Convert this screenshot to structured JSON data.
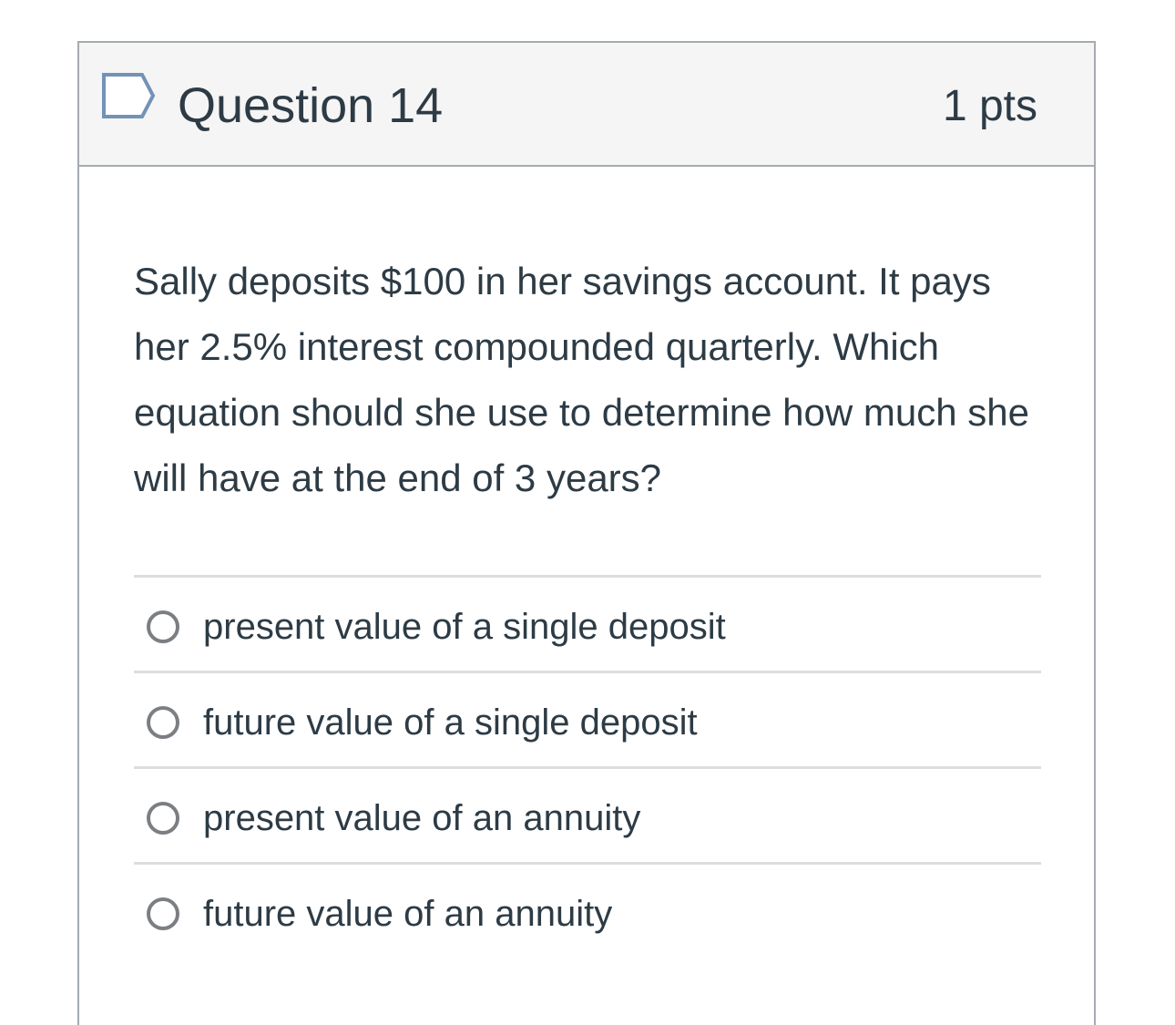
{
  "question": {
    "title": "Question 14",
    "points": "1 pts",
    "flag_icon": "flag-outline-icon",
    "text": "Sally deposits $100 in her savings account. It pays her 2.5% interest compounded quarterly. Which equation should she use to determine how much she will have at the end of 3 years?"
  },
  "answers": [
    {
      "label": "present value of a single deposit"
    },
    {
      "label": "future value of a single deposit"
    },
    {
      "label": "present value of an annuity"
    },
    {
      "label": "future value of an annuity"
    }
  ],
  "colors": {
    "text": "#2d3b45",
    "header_bg": "#f5f5f5",
    "border": "#a5abb0",
    "divider": "#dddddd",
    "radio": "#7b7f83",
    "flag": "#7392b6"
  }
}
